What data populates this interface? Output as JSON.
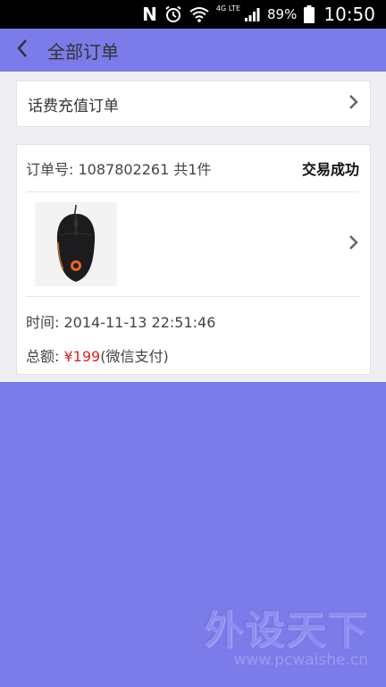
{
  "status_bar": {
    "notification_letter": "N",
    "network_type": "4G LTE",
    "battery_percent": "89%",
    "time": "10:50",
    "icons": [
      "n-notification-icon",
      "alarm-icon",
      "wifi-icon",
      "signal-icon",
      "battery-icon"
    ]
  },
  "header": {
    "back_icon": "chevron-left-icon",
    "title": "全部订单"
  },
  "recharge_card": {
    "label": "话费充值订单",
    "arrow_icon": "chevron-right-icon"
  },
  "order": {
    "number_text": "订单号: 1087802261 共1件",
    "status": "交易成功",
    "product_image": "mouse-product-image",
    "time_text": "时间: 2014-11-13 22:51:46",
    "total_label": "总额: ",
    "total_price": "¥199",
    "payment_method": "(微信支付)"
  },
  "watermark": {
    "text": "外设天下",
    "url": "www.pcwaishe.cn"
  },
  "colors": {
    "accent_bg": "#7b7ce9",
    "price_red": "#e02222",
    "content_bg": "#efeff3"
  }
}
